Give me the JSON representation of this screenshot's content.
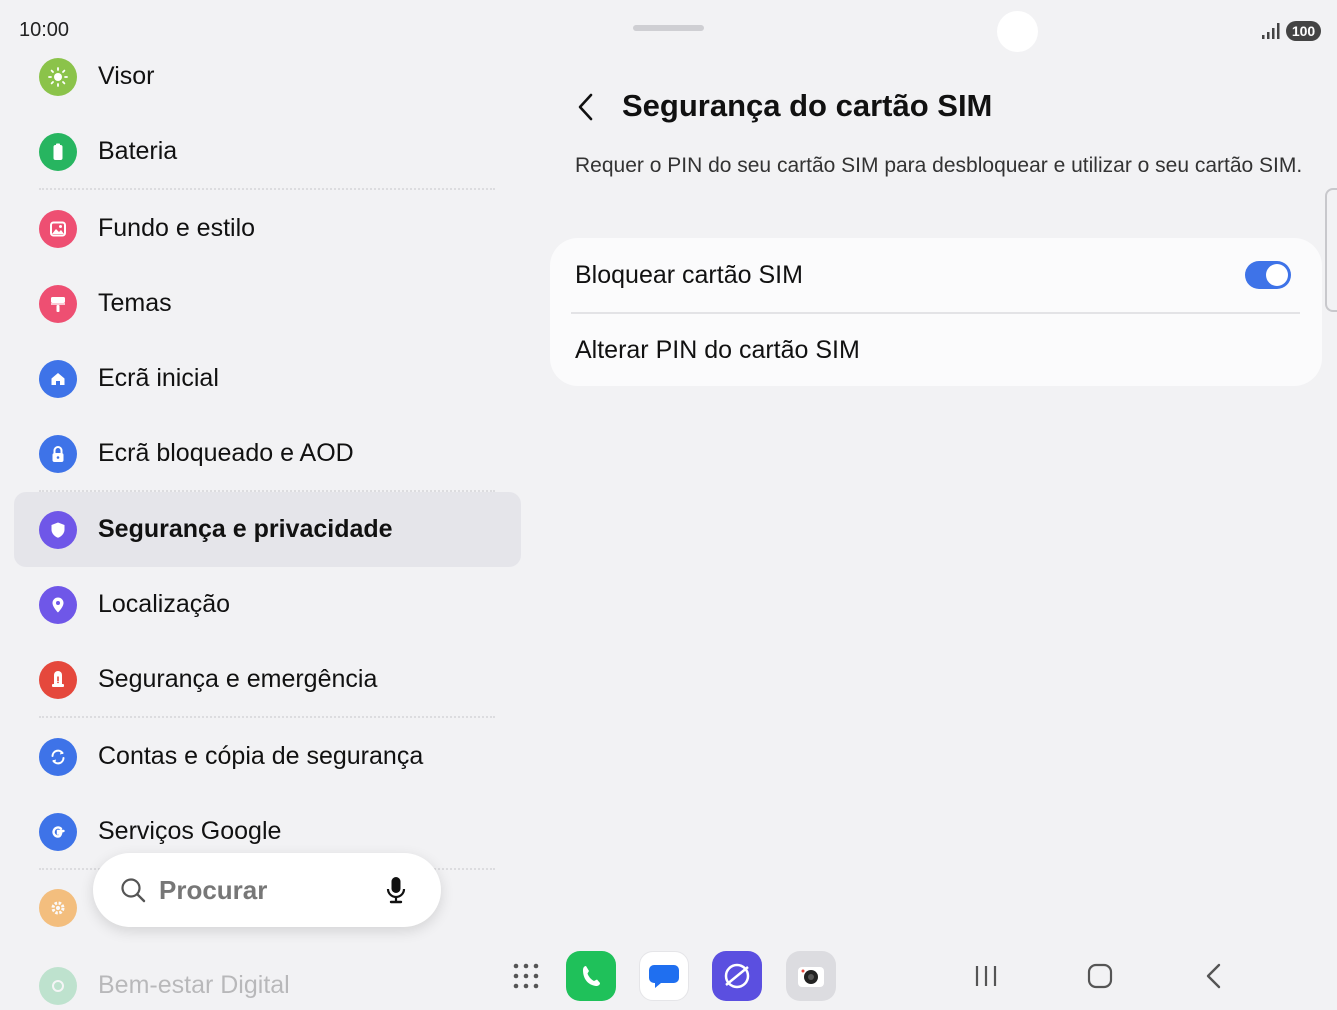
{
  "status_bar": {
    "time": "10:00",
    "battery": "100"
  },
  "sidebar": {
    "items": [
      {
        "label": "Visor",
        "icon": "sun-icon",
        "color": "#8bc34a"
      },
      {
        "label": "Bateria",
        "icon": "battery-icon",
        "color": "#27b560"
      },
      {
        "label": "Fundo e estilo",
        "icon": "image-icon",
        "color": "#ee4f72"
      },
      {
        "label": "Temas",
        "icon": "paint-roller-icon",
        "color": "#ee4f72"
      },
      {
        "label": "Ecrã inicial",
        "icon": "home-icon",
        "color": "#3e73e8"
      },
      {
        "label": "Ecrã bloqueado e AOD",
        "icon": "lock-icon",
        "color": "#3e73e8"
      },
      {
        "label": "Segurança e privacidade",
        "icon": "shield-icon",
        "color": "#6f57e8",
        "selected": true
      },
      {
        "label": "Localização",
        "icon": "location-pin-icon",
        "color": "#6f57e8"
      },
      {
        "label": "Segurança e emergência",
        "icon": "alert-icon",
        "color": "#e5483c"
      },
      {
        "label": "Contas e cópia de segurança",
        "icon": "sync-icon",
        "color": "#3e73e8"
      },
      {
        "label": "Serviços Google",
        "icon": "google-icon",
        "color": "#3e73e8"
      },
      {
        "label": "",
        "icon": "gear-icon",
        "color": "#f4a340"
      },
      {
        "label": "Bem-estar Digital",
        "icon": "wellbeing-icon",
        "color": "#27b560"
      }
    ]
  },
  "search": {
    "placeholder": "Procurar"
  },
  "main": {
    "title": "Segurança do cartão SIM",
    "description": "Requer o PIN do seu cartão SIM para desbloquear e utilizar o seu cartão SIM.",
    "options": [
      {
        "label": "Bloquear cartão SIM",
        "toggle": true
      },
      {
        "label": "Alterar PIN do cartão SIM"
      }
    ]
  },
  "dock": {
    "apps": [
      {
        "name": "phone-app-icon",
        "color": "#1fc15a"
      },
      {
        "name": "messages-app-icon",
        "color": "#ffffff"
      },
      {
        "name": "internet-app-icon",
        "color": "#5b4fe0"
      },
      {
        "name": "camera-app-icon",
        "color": "#dcdce0"
      }
    ]
  }
}
